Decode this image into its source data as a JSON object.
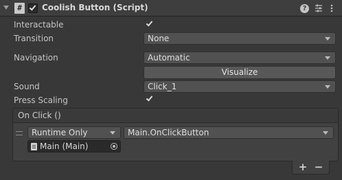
{
  "component": {
    "title": "Coolish Button (Script)",
    "enabled": true,
    "header_icons": [
      "help-icon",
      "presets-icon",
      "more-icon"
    ]
  },
  "fields": {
    "interactable": {
      "label": "Interactable",
      "checked": true
    },
    "transition": {
      "label": "Transition",
      "value": "None"
    },
    "navigation": {
      "label": "Navigation",
      "value": "Automatic"
    },
    "visualize_button": "Visualize",
    "sound": {
      "label": "Sound",
      "value": "Click_1"
    },
    "press_scaling": {
      "label": "Press Scaling",
      "checked": true
    }
  },
  "on_click": {
    "title": "On Click ()",
    "entries": [
      {
        "call_state": "Runtime Only",
        "function": "Main.OnClickButton",
        "target": "Main (Main)"
      }
    ],
    "add_label": "+",
    "remove_label": "−"
  },
  "colors": {
    "background": "#383838",
    "header": "#3e3e3e",
    "dropdown": "#515151",
    "text": "#c4c4c4"
  }
}
